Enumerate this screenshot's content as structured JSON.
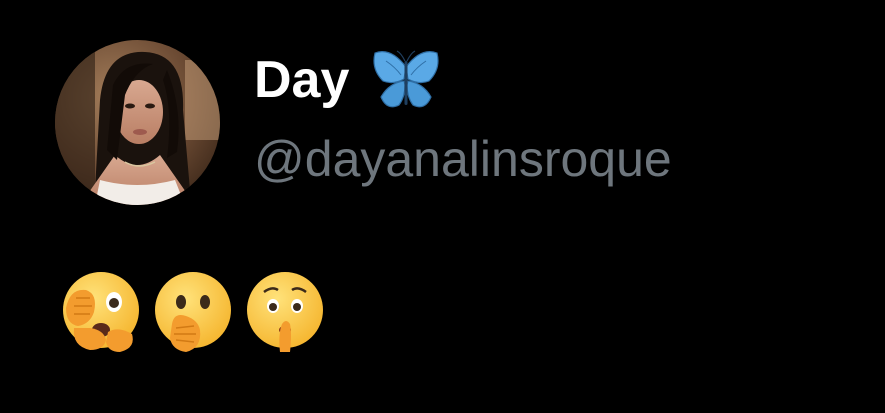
{
  "author": {
    "display_name": "Day",
    "handle": "@dayanalinsroque",
    "badge_icon": "butterfly-emoji-icon",
    "avatar": "profile-photo-avatar"
  },
  "tweet": {
    "emojis": [
      "face-with-open-eyes-and-hand-over-mouth-icon",
      "face-with-hand-over-mouth-icon",
      "shushing-face-icon"
    ]
  },
  "colors": {
    "background": "#000000",
    "name": "#ffffff",
    "handle": "#6e767d",
    "butterfly": "#5aa9e6"
  }
}
